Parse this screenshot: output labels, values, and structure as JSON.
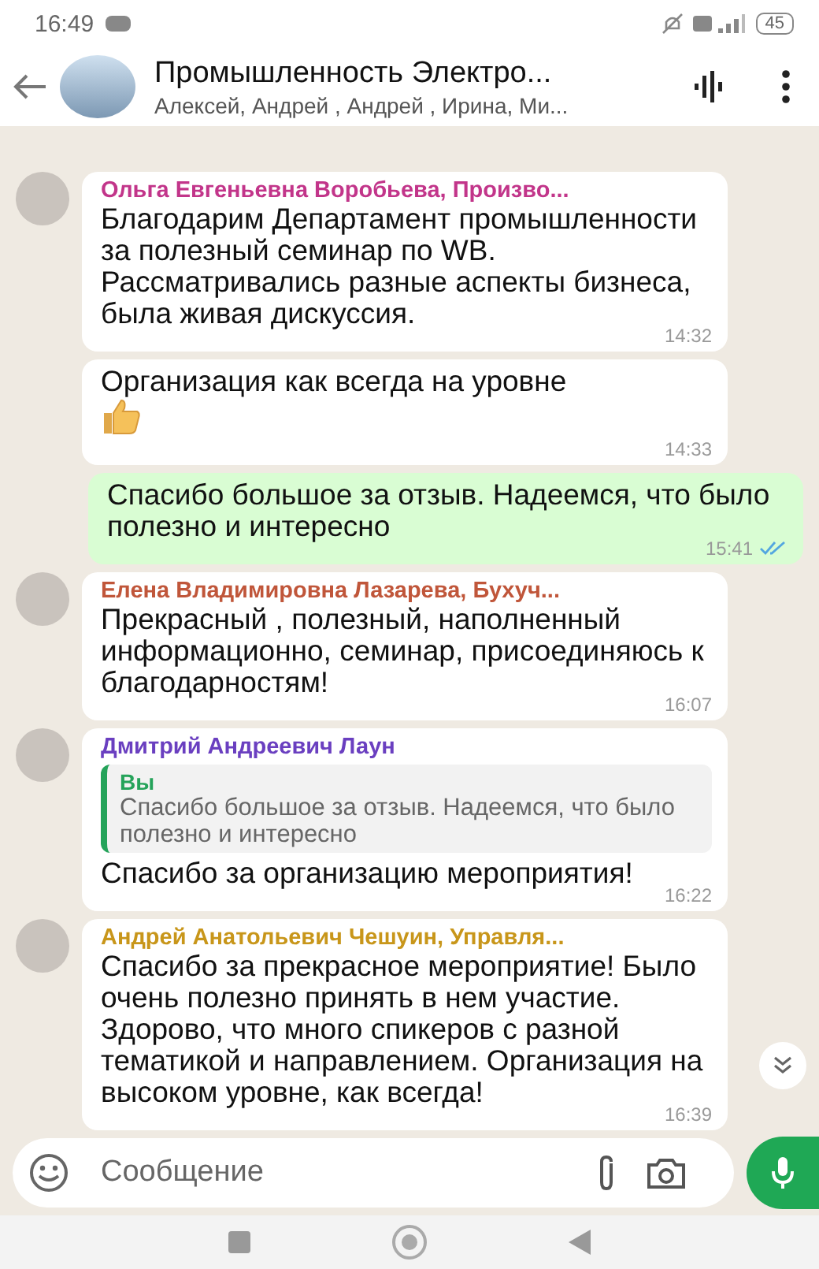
{
  "status_bar": {
    "time": "16:49",
    "battery": "45"
  },
  "header": {
    "title": "Промышленность Электро...",
    "members": "Алексей, Андрей , Андрей , Ирина, Ми..."
  },
  "messages": [
    {
      "kind": "incoming",
      "sender": "Ольга Евгеньевна Воробьева, Произво...",
      "color": "#c2358a",
      "avatar": true,
      "text": "Благодарим Департамент промышленности за полезный семинар по WB. Рассматривались разные аспекты бизнеса, была живая дискуссия.",
      "time": "14:32"
    },
    {
      "kind": "incoming",
      "avatar": false,
      "text": "Организация как всегда на уровне",
      "thumbs_up": true,
      "time": "14:33"
    },
    {
      "kind": "outgoing",
      "text": "Спасибо большое за отзыв. Надеемся, что было полезно и интересно",
      "time": "15:41",
      "read": true
    },
    {
      "kind": "incoming",
      "sender": "Елена Владимировна Лазарева, Бухуч...",
      "color": "#c0563a",
      "avatar": true,
      "text": "Прекрасный , полезный, наполненный информационно, семинар, присоединяюсь к благодарностям!",
      "time": "16:07"
    },
    {
      "kind": "incoming",
      "sender": "Дмитрий Андреевич Лаун",
      "color": "#6a3fc0",
      "avatar": true,
      "quote": {
        "author": "Вы",
        "text": "Спасибо большое за отзыв. Надеемся, что было полезно и интересно"
      },
      "text": "Спасибо за организацию мероприятия!",
      "time": "16:22"
    },
    {
      "kind": "incoming",
      "sender": "Андрей Анатольевич Чешуин, Управля...",
      "color": "#c8961a",
      "avatar": true,
      "text": "Спасибо за прекрасное мероприятие! Было очень полезно принять в нем участие. Здорово, что много спикеров с разной тематикой и направлением. Организация на высоком уровне, как всегда!",
      "time": "16:39"
    }
  ],
  "composer": {
    "placeholder": "Сообщение"
  }
}
